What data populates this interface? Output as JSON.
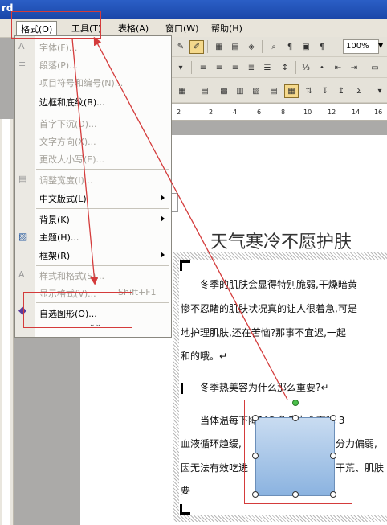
{
  "window": {
    "title_fragment": "rd"
  },
  "menubar": {
    "items": [
      {
        "label": "格式(O)",
        "active": true
      },
      {
        "label": "工具(T)"
      },
      {
        "label": "表格(A)"
      },
      {
        "label": "窗口(W)"
      },
      {
        "label": "帮助(H)"
      }
    ]
  },
  "toolbar": {
    "zoom_value": "100%"
  },
  "ruler": {
    "numbers": [
      "2",
      "2",
      "4",
      "6",
      "8",
      "10",
      "12",
      "14",
      "16"
    ]
  },
  "format_menu": {
    "items": [
      {
        "label": "字体(F)...",
        "disabled": true,
        "icon": "font-icon"
      },
      {
        "label": "段落(P)...",
        "disabled": true,
        "icon": "paragraph-icon"
      },
      {
        "label": "项目符号和编号(N)...",
        "disabled": true
      },
      {
        "label": "边框和底纹(B)...",
        "disabled": false
      },
      {
        "label": "首字下沉(D)...",
        "disabled": true
      },
      {
        "label": "文字方向(X)...",
        "disabled": true
      },
      {
        "label": "更改大小写(E)...",
        "disabled": true
      },
      {
        "label": "调整宽度(I)...",
        "disabled": true,
        "icon": "width-icon"
      },
      {
        "label": "中文版式(L)",
        "disabled": false,
        "submenu": true
      },
      {
        "label": "背景(K)",
        "disabled": false,
        "submenu": true
      },
      {
        "label": "主题(H)...",
        "disabled": false,
        "icon": "theme-icon"
      },
      {
        "label": "框架(R)",
        "disabled": false,
        "submenu": true
      },
      {
        "label": "样式和格式(S)...",
        "disabled": true,
        "icon": "styles-icon"
      },
      {
        "label": "显示格式(V)...",
        "disabled": true,
        "shortcut": "Shift+F1"
      },
      {
        "label": "自选图形(O)...",
        "disabled": false,
        "icon": "autoshape-icon"
      }
    ]
  },
  "document": {
    "title": "天气寒冷不愿护肤",
    "paragraphs": [
      "冬季的肌肤会显得特别脆弱,干燥暗黄",
      "惨不忍睹的肌肤状况真的让人很着急,可是",
      "地护理肌肤,还在苦恼?那事不宜迟,一起",
      "和的哦。↵"
    ],
    "heading": "冬季热美容为什么那么重要?↵",
    "para2": [
      "当体温每下降1℃,免疫力会下降 3",
      "血液循环趋缓,",
      "因无法有效吃进",
      "要"
    ],
    "para2_right": [
      "分力偏弱,",
      "干荒、肌肤"
    ]
  },
  "colors": {
    "annotation": "#d43b3b",
    "menu_bg": "#e8e4da",
    "shape_fill": "#a9c6ea"
  }
}
